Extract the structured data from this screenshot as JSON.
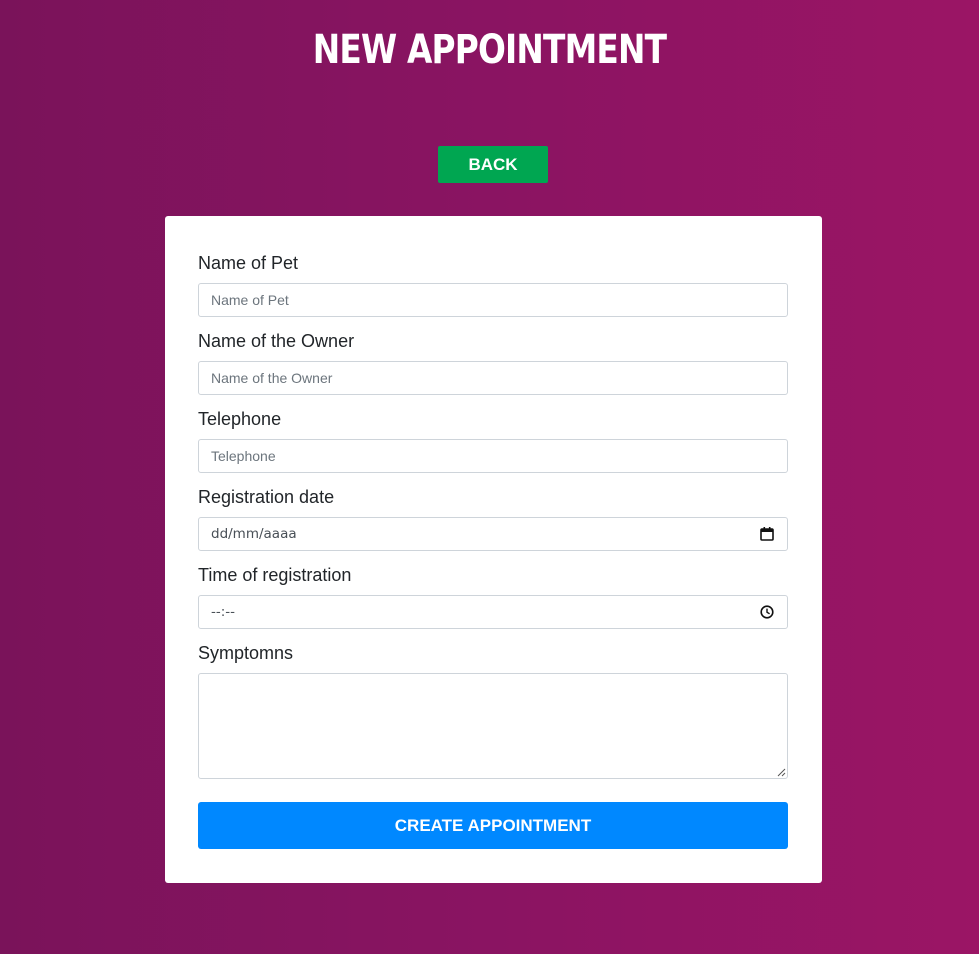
{
  "header": {
    "title": "NEW APPOINTMENT"
  },
  "nav": {
    "back_label": "BACK"
  },
  "form": {
    "pet_name": {
      "label": "Name of Pet",
      "placeholder": "Name of Pet",
      "value": ""
    },
    "owner_name": {
      "label": "Name of the Owner",
      "placeholder": "Name of the Owner",
      "value": ""
    },
    "telephone": {
      "label": "Telephone",
      "placeholder": "Telephone",
      "value": ""
    },
    "registration_date": {
      "label": "Registration date",
      "display": "dd/mm/aaaa",
      "icon": "calendar-icon"
    },
    "registration_time": {
      "label": "Time of registration",
      "display": "--:--",
      "icon": "clock-icon"
    },
    "symptoms": {
      "label": "Symptomns",
      "value": ""
    },
    "submit_label": "CREATE APPOINTMENT"
  },
  "colors": {
    "background_start": "#7a135a",
    "background_end": "#9b1565",
    "back_button": "#00a651",
    "submit_button": "#0088ff",
    "card": "#ffffff"
  }
}
